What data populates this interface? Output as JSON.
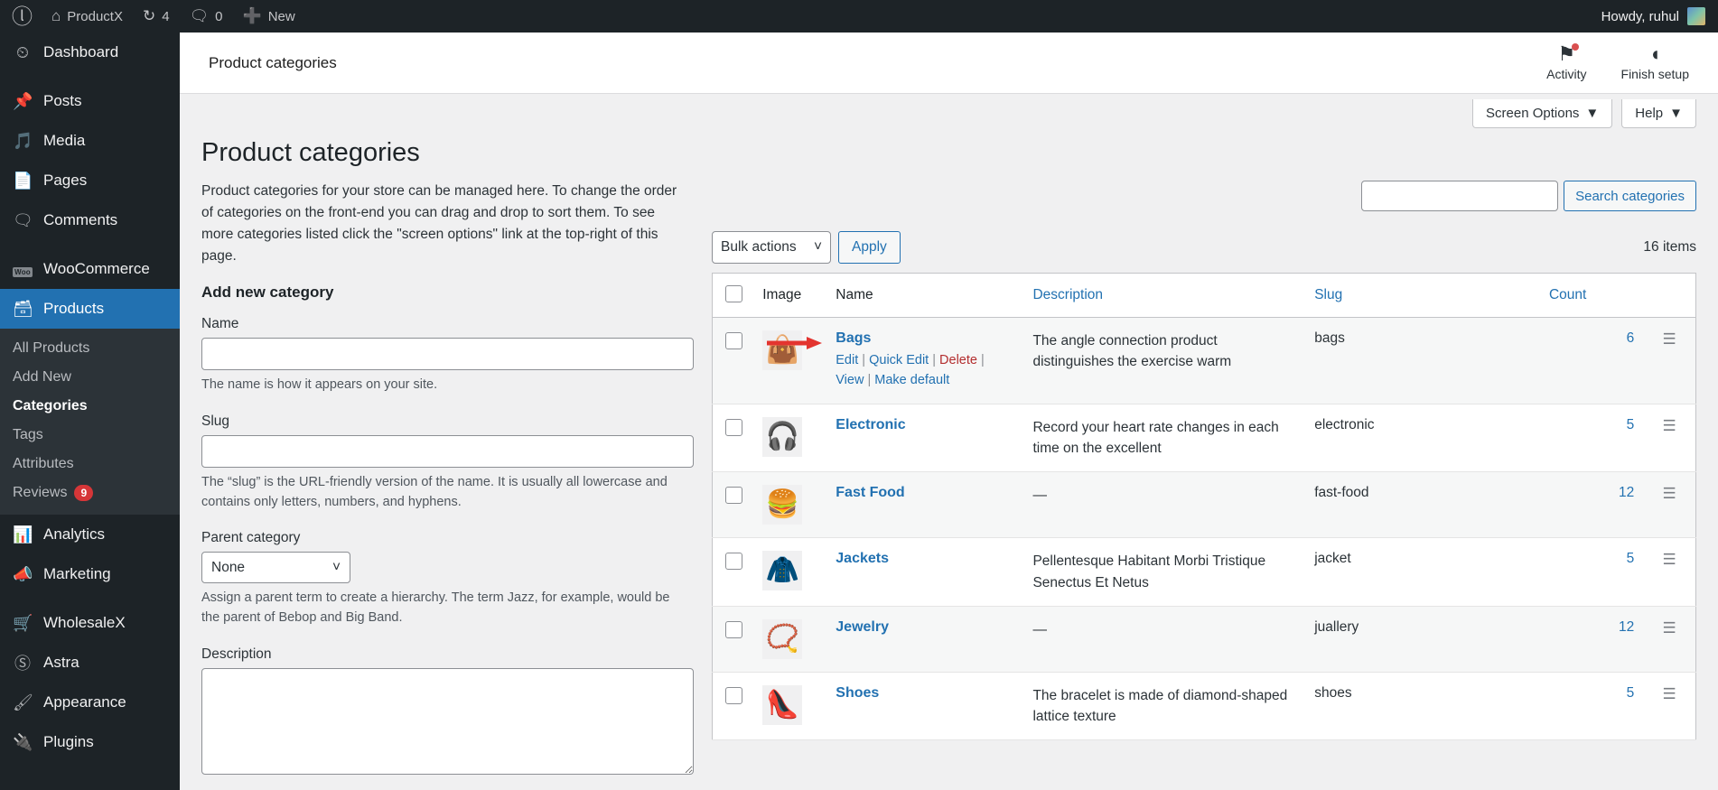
{
  "adminbar": {
    "logo_icon": "wordpress-logo",
    "site_name": "ProductX",
    "site_icon": "home-icon",
    "updates_icon": "updates-icon",
    "updates_count": "4",
    "comments_icon": "comments-icon",
    "comments_count": "0",
    "new_icon": "plus-icon",
    "new_label": "New",
    "howdy": "Howdy, ruhul",
    "avatar_name": "avatar"
  },
  "sidebar": {
    "items": [
      {
        "label": "Dashboard",
        "icon": "dashboard-icon"
      },
      {
        "label": "Posts",
        "icon": "pin-icon"
      },
      {
        "label": "Media",
        "icon": "media-icon"
      },
      {
        "label": "Pages",
        "icon": "pages-icon"
      },
      {
        "label": "Comments",
        "icon": "comment-icon"
      },
      {
        "label": "WooCommerce",
        "icon": "woo-icon"
      },
      {
        "label": "Products",
        "icon": "products-icon"
      },
      {
        "label": "Analytics",
        "icon": "analytics-icon"
      },
      {
        "label": "Marketing",
        "icon": "megaphone-icon"
      },
      {
        "label": "WholesaleX",
        "icon": "wholesalex-icon"
      },
      {
        "label": "Astra",
        "icon": "astra-icon"
      },
      {
        "label": "Appearance",
        "icon": "brush-icon"
      },
      {
        "label": "Plugins",
        "icon": "plug-icon"
      }
    ],
    "submenu": [
      {
        "label": "All Products",
        "badge": ""
      },
      {
        "label": "Add New",
        "badge": ""
      },
      {
        "label": "Categories",
        "badge": ""
      },
      {
        "label": "Tags",
        "badge": ""
      },
      {
        "label": "Attributes",
        "badge": ""
      },
      {
        "label": "Reviews",
        "badge": "9"
      }
    ],
    "active_item": "Products",
    "current_sub": "Categories",
    "accent_color": "#2271b1",
    "badge_color": "#d63638"
  },
  "wc_header": {
    "breadcrumb": "Product categories",
    "actions": [
      {
        "label": "Activity",
        "icon": "flag-icon",
        "has_dot": true
      },
      {
        "label": "Finish setup",
        "icon": "half-circle-icon",
        "has_dot": false
      }
    ]
  },
  "screen_meta": {
    "screen_options": "Screen Options",
    "help": "Help",
    "chevron": "▼"
  },
  "page": {
    "title": "Product categories",
    "intro": "Product categories for your store can be managed here. To change the order of categories on the front-end you can drag and drop to sort them. To see more categories listed click the \"screen options\" link at the top-right of this page."
  },
  "form": {
    "heading": "Add new category",
    "name_label": "Name",
    "name_value": "",
    "name_placeholder": "",
    "name_desc": "The name is how it appears on your site.",
    "slug_label": "Slug",
    "slug_value": "",
    "slug_placeholder": "",
    "slug_desc": "The “slug” is the URL-friendly version of the name. It is usually all lowercase and contains only letters, numbers, and hyphens.",
    "parent_label": "Parent category",
    "parent_value": "None",
    "parent_desc": "Assign a parent term to create a hierarchy. The term Jazz, for example, would be the parent of Bebop and Big Band.",
    "description_label": "Description",
    "description_value": ""
  },
  "search": {
    "value": "",
    "placeholder": "",
    "button_label": "Search categories"
  },
  "tablenav": {
    "bulk_label": "Bulk actions",
    "apply_label": "Apply",
    "items_count": "16 items",
    "chevron": "⌄"
  },
  "table": {
    "columns": [
      "Image",
      "Name",
      "Description",
      "Slug",
      "Count"
    ],
    "handle_icon": "drag-handle-icon",
    "rows": [
      {
        "checked": false,
        "image_icon": "👜",
        "name": "Bags",
        "description": "The angle connection product distinguishes the exercise warm",
        "slug": "bags",
        "count": "6",
        "actions": [
          "Edit",
          "Quick Edit",
          "Delete",
          "View",
          "Make default"
        ],
        "show_actions": true,
        "has_pointer": true
      },
      {
        "checked": false,
        "image_icon": "🎧",
        "name": "Electronic",
        "description": "Record your heart rate changes in each time on the excellent",
        "slug": "electronic",
        "count": "5",
        "actions": [],
        "show_actions": false,
        "has_pointer": false
      },
      {
        "checked": false,
        "image_icon": "🍔",
        "name": "Fast Food",
        "description": "—",
        "slug": "fast-food",
        "count": "12",
        "actions": [],
        "show_actions": false,
        "has_pointer": false
      },
      {
        "checked": false,
        "image_icon": "🧥",
        "name": "Jackets",
        "description": "Pellentesque Habitant Morbi Tristique Senectus Et Netus",
        "slug": "jacket",
        "count": "5",
        "actions": [],
        "show_actions": false,
        "has_pointer": false
      },
      {
        "checked": false,
        "image_icon": "📿",
        "name": "Jewelry",
        "description": "—",
        "slug": "juallery",
        "count": "12",
        "actions": [],
        "show_actions": false,
        "has_pointer": false
      },
      {
        "checked": false,
        "image_icon": "👠",
        "name": "Shoes",
        "description": "The bracelet is made of diamond-shaped lattice texture",
        "slug": "shoes",
        "count": "5",
        "actions": [],
        "show_actions": false,
        "has_pointer": false
      }
    ]
  },
  "colors": {
    "admin_bg": "#1d2327",
    "accent": "#2271b1",
    "danger": "#b32d2e",
    "page_bg": "#f0f0f1"
  }
}
